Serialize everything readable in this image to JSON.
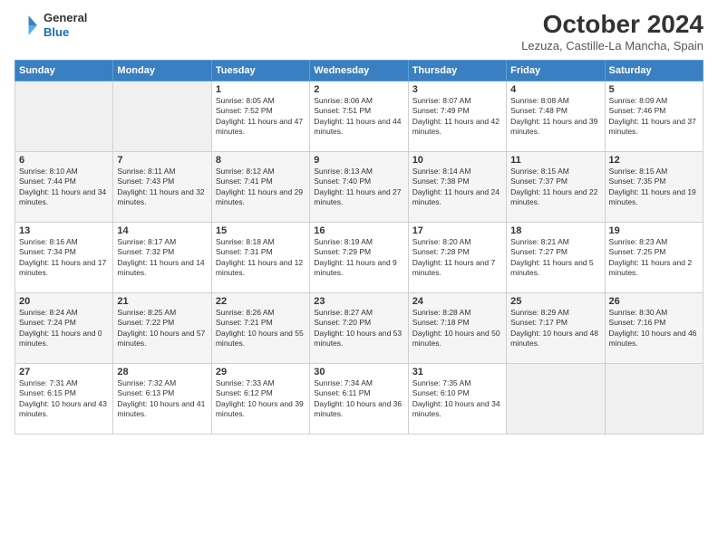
{
  "logo": {
    "general": "General",
    "blue": "Blue"
  },
  "title": "October 2024",
  "location": "Lezuza, Castille-La Mancha, Spain",
  "days_of_week": [
    "Sunday",
    "Monday",
    "Tuesday",
    "Wednesday",
    "Thursday",
    "Friday",
    "Saturday"
  ],
  "weeks": [
    [
      {
        "day": "",
        "sunrise": "",
        "sunset": "",
        "daylight": ""
      },
      {
        "day": "",
        "sunrise": "",
        "sunset": "",
        "daylight": ""
      },
      {
        "day": "1",
        "sunrise": "Sunrise: 8:05 AM",
        "sunset": "Sunset: 7:52 PM",
        "daylight": "Daylight: 11 hours and 47 minutes."
      },
      {
        "day": "2",
        "sunrise": "Sunrise: 8:06 AM",
        "sunset": "Sunset: 7:51 PM",
        "daylight": "Daylight: 11 hours and 44 minutes."
      },
      {
        "day": "3",
        "sunrise": "Sunrise: 8:07 AM",
        "sunset": "Sunset: 7:49 PM",
        "daylight": "Daylight: 11 hours and 42 minutes."
      },
      {
        "day": "4",
        "sunrise": "Sunrise: 8:08 AM",
        "sunset": "Sunset: 7:48 PM",
        "daylight": "Daylight: 11 hours and 39 minutes."
      },
      {
        "day": "5",
        "sunrise": "Sunrise: 8:09 AM",
        "sunset": "Sunset: 7:46 PM",
        "daylight": "Daylight: 11 hours and 37 minutes."
      }
    ],
    [
      {
        "day": "6",
        "sunrise": "Sunrise: 8:10 AM",
        "sunset": "Sunset: 7:44 PM",
        "daylight": "Daylight: 11 hours and 34 minutes."
      },
      {
        "day": "7",
        "sunrise": "Sunrise: 8:11 AM",
        "sunset": "Sunset: 7:43 PM",
        "daylight": "Daylight: 11 hours and 32 minutes."
      },
      {
        "day": "8",
        "sunrise": "Sunrise: 8:12 AM",
        "sunset": "Sunset: 7:41 PM",
        "daylight": "Daylight: 11 hours and 29 minutes."
      },
      {
        "day": "9",
        "sunrise": "Sunrise: 8:13 AM",
        "sunset": "Sunset: 7:40 PM",
        "daylight": "Daylight: 11 hours and 27 minutes."
      },
      {
        "day": "10",
        "sunrise": "Sunrise: 8:14 AM",
        "sunset": "Sunset: 7:38 PM",
        "daylight": "Daylight: 11 hours and 24 minutes."
      },
      {
        "day": "11",
        "sunrise": "Sunrise: 8:15 AM",
        "sunset": "Sunset: 7:37 PM",
        "daylight": "Daylight: 11 hours and 22 minutes."
      },
      {
        "day": "12",
        "sunrise": "Sunrise: 8:15 AM",
        "sunset": "Sunset: 7:35 PM",
        "daylight": "Daylight: 11 hours and 19 minutes."
      }
    ],
    [
      {
        "day": "13",
        "sunrise": "Sunrise: 8:16 AM",
        "sunset": "Sunset: 7:34 PM",
        "daylight": "Daylight: 11 hours and 17 minutes."
      },
      {
        "day": "14",
        "sunrise": "Sunrise: 8:17 AM",
        "sunset": "Sunset: 7:32 PM",
        "daylight": "Daylight: 11 hours and 14 minutes."
      },
      {
        "day": "15",
        "sunrise": "Sunrise: 8:18 AM",
        "sunset": "Sunset: 7:31 PM",
        "daylight": "Daylight: 11 hours and 12 minutes."
      },
      {
        "day": "16",
        "sunrise": "Sunrise: 8:19 AM",
        "sunset": "Sunset: 7:29 PM",
        "daylight": "Daylight: 11 hours and 9 minutes."
      },
      {
        "day": "17",
        "sunrise": "Sunrise: 8:20 AM",
        "sunset": "Sunset: 7:28 PM",
        "daylight": "Daylight: 11 hours and 7 minutes."
      },
      {
        "day": "18",
        "sunrise": "Sunrise: 8:21 AM",
        "sunset": "Sunset: 7:27 PM",
        "daylight": "Daylight: 11 hours and 5 minutes."
      },
      {
        "day": "19",
        "sunrise": "Sunrise: 8:23 AM",
        "sunset": "Sunset: 7:25 PM",
        "daylight": "Daylight: 11 hours and 2 minutes."
      }
    ],
    [
      {
        "day": "20",
        "sunrise": "Sunrise: 8:24 AM",
        "sunset": "Sunset: 7:24 PM",
        "daylight": "Daylight: 11 hours and 0 minutes."
      },
      {
        "day": "21",
        "sunrise": "Sunrise: 8:25 AM",
        "sunset": "Sunset: 7:22 PM",
        "daylight": "Daylight: 10 hours and 57 minutes."
      },
      {
        "day": "22",
        "sunrise": "Sunrise: 8:26 AM",
        "sunset": "Sunset: 7:21 PM",
        "daylight": "Daylight: 10 hours and 55 minutes."
      },
      {
        "day": "23",
        "sunrise": "Sunrise: 8:27 AM",
        "sunset": "Sunset: 7:20 PM",
        "daylight": "Daylight: 10 hours and 53 minutes."
      },
      {
        "day": "24",
        "sunrise": "Sunrise: 8:28 AM",
        "sunset": "Sunset: 7:18 PM",
        "daylight": "Daylight: 10 hours and 50 minutes."
      },
      {
        "day": "25",
        "sunrise": "Sunrise: 8:29 AM",
        "sunset": "Sunset: 7:17 PM",
        "daylight": "Daylight: 10 hours and 48 minutes."
      },
      {
        "day": "26",
        "sunrise": "Sunrise: 8:30 AM",
        "sunset": "Sunset: 7:16 PM",
        "daylight": "Daylight: 10 hours and 46 minutes."
      }
    ],
    [
      {
        "day": "27",
        "sunrise": "Sunrise: 7:31 AM",
        "sunset": "Sunset: 6:15 PM",
        "daylight": "Daylight: 10 hours and 43 minutes."
      },
      {
        "day": "28",
        "sunrise": "Sunrise: 7:32 AM",
        "sunset": "Sunset: 6:13 PM",
        "daylight": "Daylight: 10 hours and 41 minutes."
      },
      {
        "day": "29",
        "sunrise": "Sunrise: 7:33 AM",
        "sunset": "Sunset: 6:12 PM",
        "daylight": "Daylight: 10 hours and 39 minutes."
      },
      {
        "day": "30",
        "sunrise": "Sunrise: 7:34 AM",
        "sunset": "Sunset: 6:11 PM",
        "daylight": "Daylight: 10 hours and 36 minutes."
      },
      {
        "day": "31",
        "sunrise": "Sunrise: 7:35 AM",
        "sunset": "Sunset: 6:10 PM",
        "daylight": "Daylight: 10 hours and 34 minutes."
      },
      {
        "day": "",
        "sunrise": "",
        "sunset": "",
        "daylight": ""
      },
      {
        "day": "",
        "sunrise": "",
        "sunset": "",
        "daylight": ""
      }
    ]
  ]
}
